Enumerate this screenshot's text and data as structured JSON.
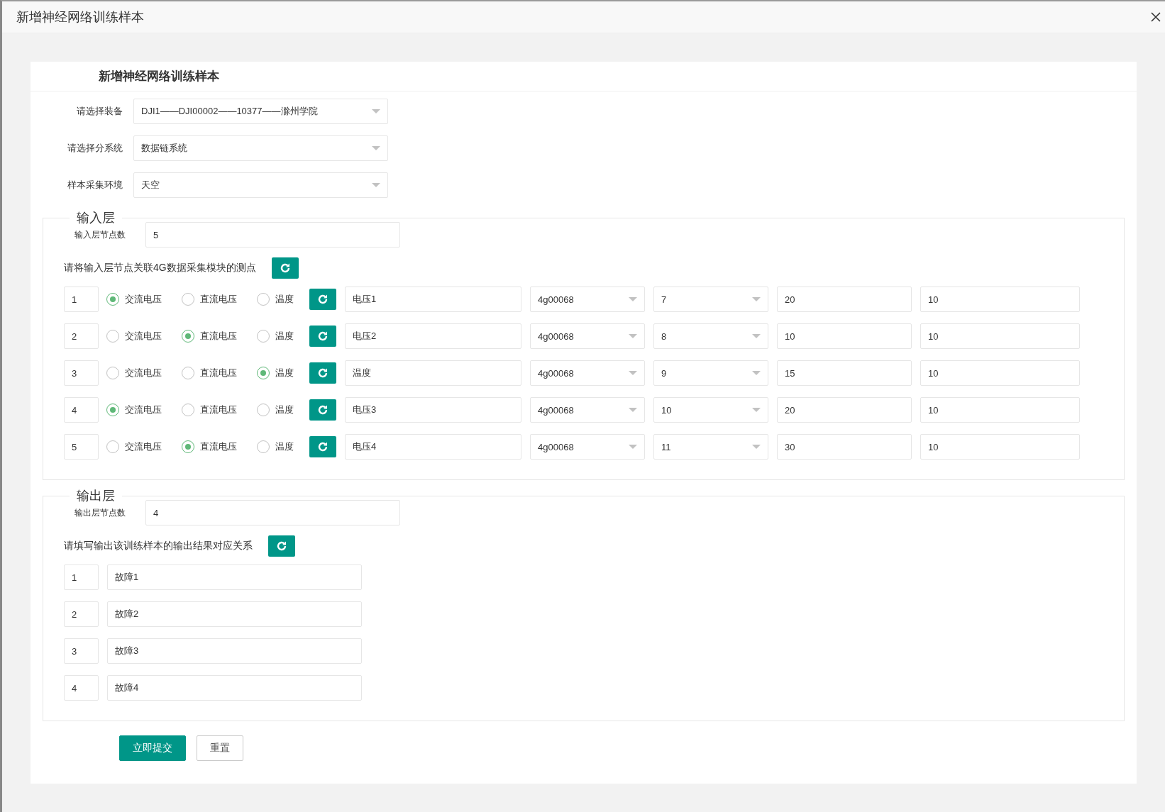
{
  "dialog": {
    "title": "新增神经网络训练样本"
  },
  "form": {
    "title": "新增神经网络训练样本",
    "selects": [
      {
        "label": "请选择装备",
        "value": "DJI1——DJI00002——10377——滁州学院"
      },
      {
        "label": "请选择分系统",
        "value": "数据链系统"
      },
      {
        "label": "样本采集环境",
        "value": "天空"
      }
    ]
  },
  "input_layer": {
    "legend": "输入层",
    "node_count_label": "输入层节点数",
    "node_count": "5",
    "prompt": "请将输入层节点关联4G数据采集模块的测点",
    "rows": [
      {
        "index": "1",
        "options": [
          {
            "label": "交流电压",
            "selected": true
          },
          {
            "label": "直流电压",
            "selected": false
          },
          {
            "label": "温度",
            "selected": false
          }
        ],
        "name": "电压1",
        "module": "4g00068",
        "channel": "7",
        "value_1": "20",
        "value_2": "10"
      },
      {
        "index": "2",
        "options": [
          {
            "label": "交流电压",
            "selected": false
          },
          {
            "label": "直流电压",
            "selected": true
          },
          {
            "label": "温度",
            "selected": false
          }
        ],
        "name": "电压2",
        "module": "4g00068",
        "channel": "8",
        "value_1": "10",
        "value_2": "10"
      },
      {
        "index": "3",
        "options": [
          {
            "label": "交流电压",
            "selected": false
          },
          {
            "label": "直流电压",
            "selected": false
          },
          {
            "label": "温度",
            "selected": true
          }
        ],
        "name": "温度",
        "module": "4g00068",
        "channel": "9",
        "value_1": "15",
        "value_2": "10"
      },
      {
        "index": "4",
        "options": [
          {
            "label": "交流电压",
            "selected": true
          },
          {
            "label": "直流电压",
            "selected": false
          },
          {
            "label": "温度",
            "selected": false
          }
        ],
        "name": "电压3",
        "module": "4g00068",
        "channel": "10",
        "value_1": "20",
        "value_2": "10"
      },
      {
        "index": "5",
        "options": [
          {
            "label": "交流电压",
            "selected": false
          },
          {
            "label": "直流电压",
            "selected": true
          },
          {
            "label": "温度",
            "selected": false
          }
        ],
        "name": "电压4",
        "module": "4g00068",
        "channel": "11",
        "value_1": "30",
        "value_2": "10"
      }
    ]
  },
  "output_layer": {
    "legend": "输出层",
    "node_count_label": "输出层节点数",
    "node_count": "4",
    "prompt": "请填写输出该训练样本的输出结果对应关系",
    "rows": [
      {
        "index": "1",
        "value": "故障1"
      },
      {
        "index": "2",
        "value": "故障2"
      },
      {
        "index": "3",
        "value": "故障3"
      },
      {
        "index": "4",
        "value": "故障4"
      }
    ]
  },
  "buttons": [
    {
      "label": "立即提交",
      "kind": "primary"
    },
    {
      "label": "重置",
      "kind": "default"
    }
  ]
}
